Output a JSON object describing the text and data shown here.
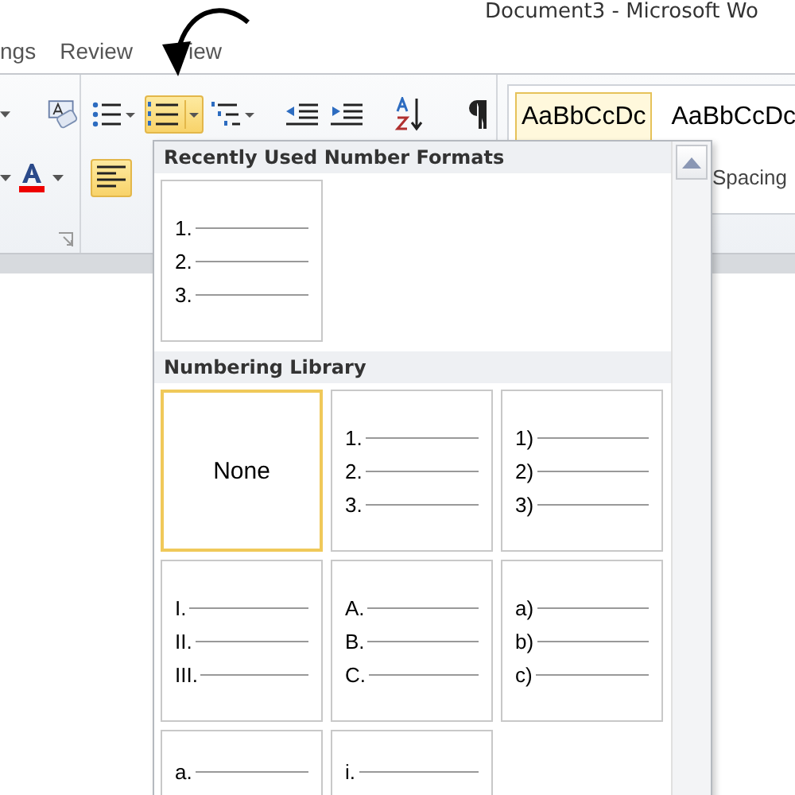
{
  "window": {
    "title": "Document3 - Microsoft Wo"
  },
  "tabs": [
    {
      "label": "ngs",
      "selected": false
    },
    {
      "label": "Review",
      "selected": false
    },
    {
      "label": "iew",
      "selected": false
    }
  ],
  "toolbar": {
    "numbering_active": true,
    "align_left_active": true
  },
  "styles": [
    {
      "preview": "AaBbCcDc",
      "selected": true
    },
    {
      "preview": "AaBbCcDc",
      "selected": false
    }
  ],
  "style_caption": "Spacing",
  "menu": {
    "sections": [
      {
        "title": "Recently Used Number Formats",
        "items": [
          {
            "kind": "list",
            "markers": [
              "1.",
              "2.",
              "3."
            ],
            "selected": false
          }
        ]
      },
      {
        "title": "Numbering Library",
        "items": [
          {
            "kind": "none",
            "label": "None",
            "selected": true
          },
          {
            "kind": "list",
            "markers": [
              "1.",
              "2.",
              "3."
            ],
            "selected": false
          },
          {
            "kind": "list",
            "markers": [
              "1)",
              "2)",
              "3)"
            ],
            "selected": false
          },
          {
            "kind": "list",
            "markers": [
              "I.",
              "II.",
              "III."
            ],
            "selected": false
          },
          {
            "kind": "list",
            "markers": [
              "A.",
              "B.",
              "C."
            ],
            "selected": false
          },
          {
            "kind": "list",
            "markers": [
              "a)",
              "b)",
              "c)"
            ],
            "selected": false
          },
          {
            "kind": "list",
            "markers": [
              "a."
            ],
            "selected": false
          },
          {
            "kind": "list",
            "markers": [
              "i."
            ],
            "selected": false
          }
        ]
      }
    ]
  }
}
